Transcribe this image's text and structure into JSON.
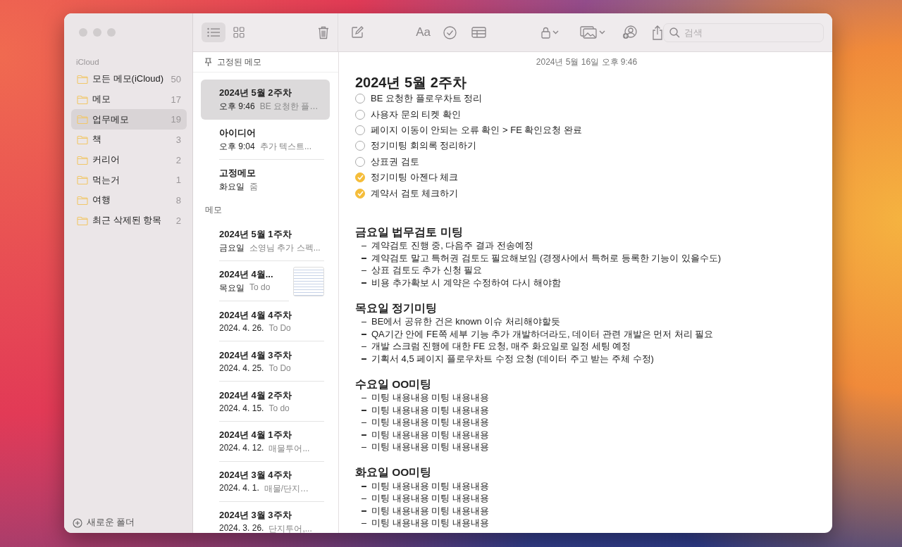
{
  "sidebar": {
    "account": "iCloud",
    "folders": [
      {
        "name": "모든 메모(iCloud)",
        "count": "50",
        "selected": false
      },
      {
        "name": "메모",
        "count": "17",
        "selected": false
      },
      {
        "name": "업무메모",
        "count": "19",
        "selected": true
      },
      {
        "name": "책",
        "count": "3",
        "selected": false
      },
      {
        "name": "커리어",
        "count": "2",
        "selected": false
      },
      {
        "name": "먹는거",
        "count": "1",
        "selected": false
      },
      {
        "name": "여행",
        "count": "8",
        "selected": false
      },
      {
        "name": "최근 삭제된 항목",
        "count": "2",
        "selected": false
      }
    ],
    "new_folder": "새로운 폴더"
  },
  "view_modes": [
    {
      "kind": "list",
      "selected": true
    },
    {
      "kind": "gallery",
      "selected": false
    }
  ],
  "note_list": {
    "pinned_header": "고정된 메모",
    "pinned": [
      {
        "title": "2024년 5월 2주차",
        "date": "오후 9:46",
        "preview": "BE 요청한 플…",
        "selected": true,
        "thumbnail": false
      },
      {
        "title": "아이디어",
        "date": "오후 9:04",
        "preview": "추가 텍스트...",
        "selected": false,
        "thumbnail": false
      },
      {
        "title": "고정메모",
        "date": "화요일",
        "preview": "줌",
        "selected": false,
        "thumbnail": false
      }
    ],
    "section_header": "메모",
    "notes": [
      {
        "title": "2024년 5월 1주차",
        "date": "금요일",
        "preview": "소영님 추가 스펙...",
        "selected": false,
        "thumbnail": false
      },
      {
        "title": "2024년 4월...",
        "date": "목요일",
        "preview": "To do",
        "selected": false,
        "thumbnail": true
      },
      {
        "title": "2024년 4월 4주차",
        "date": "2024. 4. 26.",
        "preview": "To Do",
        "selected": false,
        "thumbnail": false
      },
      {
        "title": "2024년 4월 3주차",
        "date": "2024. 4. 25.",
        "preview": "To Do",
        "selected": false,
        "thumbnail": false
      },
      {
        "title": "2024년 4월 2주차",
        "date": "2024. 4. 15.",
        "preview": "To do",
        "selected": false,
        "thumbnail": false
      },
      {
        "title": "2024년 4월 1주차",
        "date": "2024. 4. 12.",
        "preview": "매물투어...",
        "selected": false,
        "thumbnail": false
      },
      {
        "title": "2024년 3월 4주차",
        "date": "2024. 4. 1.",
        "preview": "매물/단지…",
        "selected": false,
        "thumbnail": false
      },
      {
        "title": "2024년 3월 3주차",
        "date": "2024. 3. 26.",
        "preview": "단지투어,...",
        "selected": false,
        "thumbnail": false
      }
    ]
  },
  "toolbar": {
    "format_label": "Aa",
    "search": {
      "placeholder": "검색"
    }
  },
  "note": {
    "timestamp": "2024년 5월 16일 오후 9:46",
    "title": "2024년 5월 2주차",
    "checklist": [
      {
        "text": "BE 요청한 플로우차트 정리",
        "checked": false
      },
      {
        "text": "사용자 문의 티켓 확인",
        "checked": false
      },
      {
        "text": "페이지 이동이 안되는 오류 확인 > FE 확인요청 완료",
        "checked": false
      },
      {
        "text": "정기미팅 회의록 정리하기",
        "checked": false
      },
      {
        "text": "상표권 검토",
        "checked": false
      },
      {
        "text": "정기미팅 아젠다 체크",
        "checked": true
      },
      {
        "text": "계약서 검토 체크하기",
        "checked": true
      }
    ],
    "sections": [
      {
        "heading": "금요일 법무검토 미팅",
        "items": [
          "계약검토 진행 중, 다음주 결과 전송예정",
          "계약검토 말고 특허권 검토도 필요해보임 (경쟁사에서 특허로 등록한 기능이 있을수도)",
          "상표 검토도 추가 신청 필요",
          "비용 추가확보 시 계약은 수정하여 다시 해야함"
        ]
      },
      {
        "heading": "목요일 정기미팅",
        "items": [
          "BE에서 공유한 건은 known 이슈 처리해야할듯",
          "QA기간 안에 FE쪽 세부 기능 추가 개발하더라도, 데이터 관련 개발은 먼저 처리 필요",
          "개발 스크럼 진행에 대한 FE 요청, 매주 화요일로 일정 세팅 예정",
          "기획서 4,5 페이지 플로우차트 수정 요청 (데이터 주고 받는 주체 수정)"
        ]
      },
      {
        "heading": "수요일 OO미팅",
        "items": [
          "미팅 내용내용 미팅 내용내용",
          "미팅 내용내용 미팅 내용내용",
          "미팅 내용내용 미팅 내용내용",
          "미팅 내용내용 미팅 내용내용",
          "미팅 내용내용 미팅 내용내용"
        ]
      },
      {
        "heading": "화요일 OO미팅",
        "items": [
          "미팅 내용내용 미팅 내용내용",
          "미팅 내용내용 미팅 내용내용",
          "미팅 내용내용 미팅 내용내용",
          "미팅 내용내용 미팅 내용내용"
        ]
      }
    ]
  }
}
